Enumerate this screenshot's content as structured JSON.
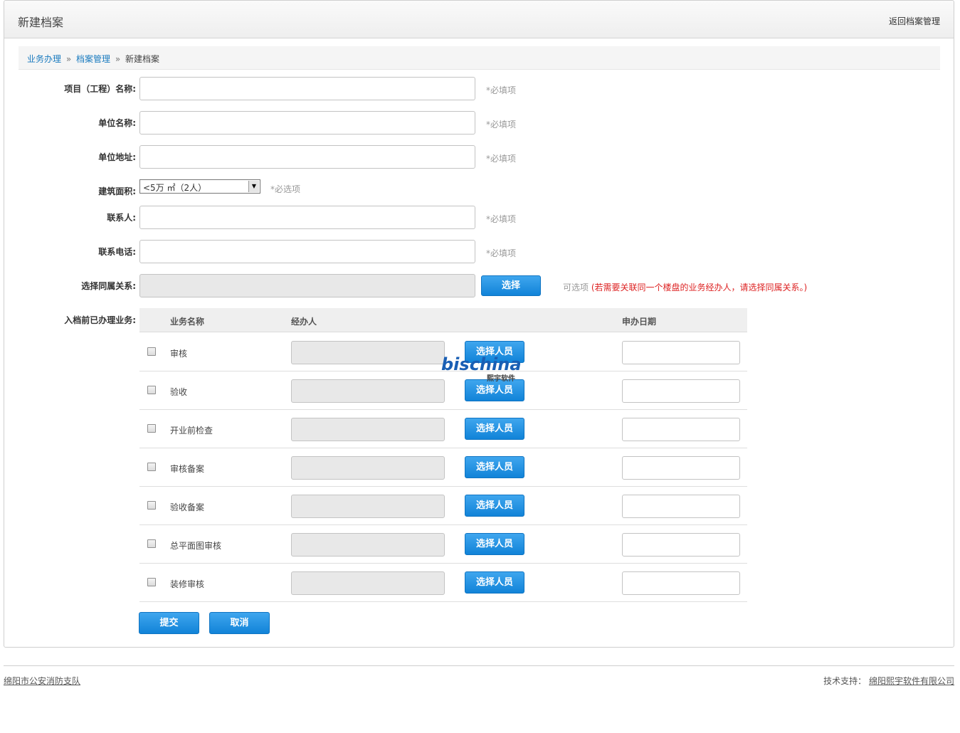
{
  "header": {
    "title": "新建档案",
    "back_link": "返回档案管理"
  },
  "breadcrumb": {
    "items": [
      "业务办理",
      "档案管理"
    ],
    "separator": "»",
    "current": "新建档案"
  },
  "form": {
    "project_name": {
      "label": "项目（工程）名称:",
      "value": "",
      "hint": "*必填项"
    },
    "unit_name": {
      "label": "单位名称:",
      "value": "",
      "hint": "*必填项"
    },
    "unit_address": {
      "label": "单位地址:",
      "value": "",
      "hint": "*必填项"
    },
    "building_area": {
      "label": "建筑面积:",
      "selected": "<5万 ㎡（2人）",
      "hint": "*必选项"
    },
    "contact": {
      "label": "联系人:",
      "value": "",
      "hint": "*必填项"
    },
    "phone": {
      "label": "联系电话:",
      "value": "",
      "hint": "*必填项"
    },
    "relation": {
      "label": "选择同属关系:",
      "value": "",
      "button": "选择",
      "hint_optional": "可选项",
      "hint_warn": "(若需要关联同一个楼盘的业务经办人，请选择同属关系。)"
    },
    "prior_business": {
      "label": "入档前已办理业务:"
    }
  },
  "business_table": {
    "columns": {
      "name": "业务名称",
      "handler": "经办人",
      "date": "申办日期"
    },
    "select_button": "选择人员",
    "rows": [
      {
        "name": "审核",
        "checked": false,
        "handler": "",
        "date": ""
      },
      {
        "name": "验收",
        "checked": false,
        "handler": "",
        "date": ""
      },
      {
        "name": "开业前检查",
        "checked": false,
        "handler": "",
        "date": ""
      },
      {
        "name": "审核备案",
        "checked": false,
        "handler": "",
        "date": ""
      },
      {
        "name": "验收备案",
        "checked": false,
        "handler": "",
        "date": ""
      },
      {
        "name": "总平面图审核",
        "checked": false,
        "handler": "",
        "date": ""
      },
      {
        "name": "装修审核",
        "checked": false,
        "handler": "",
        "date": ""
      }
    ]
  },
  "actions": {
    "submit": "提交",
    "cancel": "取消"
  },
  "watermark": {
    "logo": "bischina",
    "sub": "熙宇软件"
  },
  "footer": {
    "left": "绵阳市公安消防支队",
    "support_label": "技术支持：",
    "support_company": "绵阳熙宇软件有限公司"
  },
  "colors": {
    "accent": "#1a84d8",
    "link": "#1a7bbf",
    "warn": "#dd2222"
  }
}
